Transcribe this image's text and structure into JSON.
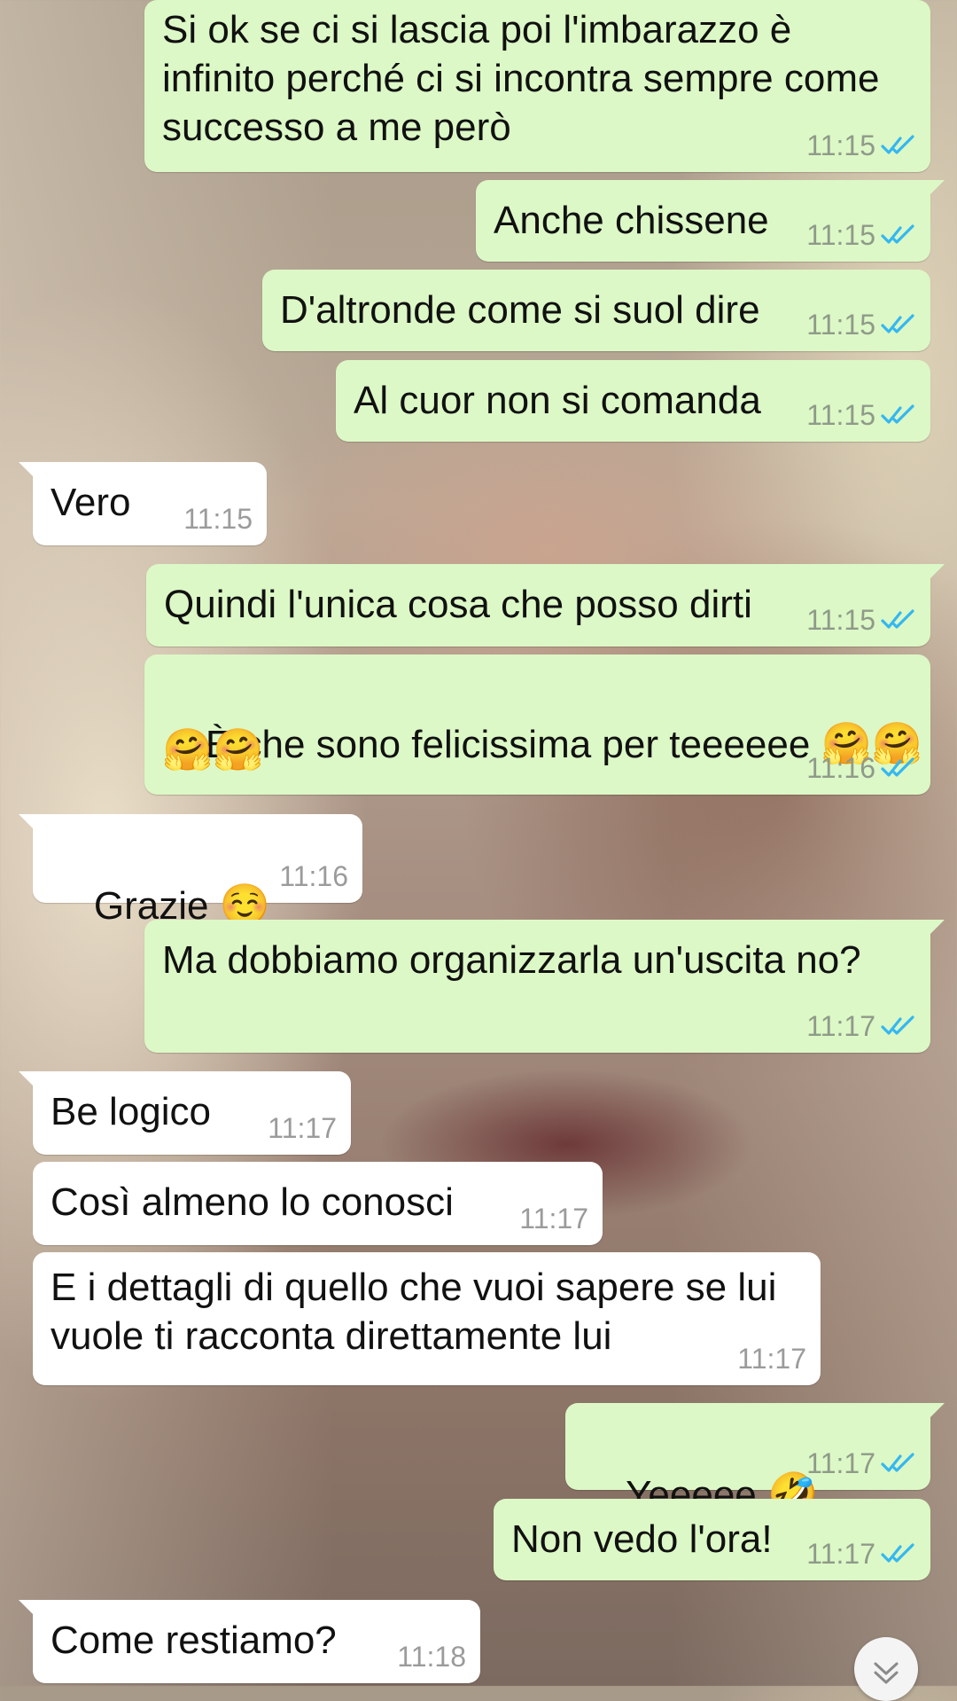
{
  "messages": [
    {
      "direction": "out",
      "lines": "Si ok se ci si lascia poi l'imbarazzo è\ninfinito perché ci si incontra sempre come\nsuccesso a me però",
      "time": "11:15",
      "read": true
    },
    {
      "direction": "out",
      "lines": "Anche chissene",
      "time": "11:15",
      "read": true
    },
    {
      "direction": "out",
      "lines": "D'altronde come si suol dire",
      "time": "11:15",
      "read": true
    },
    {
      "direction": "out",
      "lines": "Al cuor non si comanda",
      "time": "11:15",
      "read": true
    },
    {
      "direction": "in",
      "lines": "Vero",
      "time": "11:15"
    },
    {
      "direction": "out",
      "lines": "Quindi l'unica cosa che posso dirti",
      "time": "11:15",
      "read": true
    },
    {
      "direction": "out",
      "lines": "È che sono felicissima per teeeeee",
      "emoji_a": "🤗🤗",
      "emoji_b": "🤗🤗",
      "time": "11:16",
      "read": true
    },
    {
      "direction": "in",
      "lines": "Grazie",
      "emoji": "☺️",
      "time": "11:16"
    },
    {
      "direction": "out",
      "lines": "Ma dobbiamo organizzarla un'uscita no?",
      "time": "11:17",
      "read": true
    },
    {
      "direction": "in",
      "lines": "Be logico",
      "time": "11:17"
    },
    {
      "direction": "in",
      "lines": "Così almeno lo conosci",
      "time": "11:17"
    },
    {
      "direction": "in",
      "lines": "E i dettagli di quello che vuoi sapere se lui\nvuole ti racconta direttamente lui",
      "time": "11:17"
    },
    {
      "direction": "out",
      "lines": "Yeeeee",
      "emoji": "🤣",
      "time": "11:17",
      "read": true
    },
    {
      "direction": "out",
      "lines": "Non vedo l'ora!",
      "time": "11:17",
      "read": true
    },
    {
      "direction": "in",
      "lines": "Come restiamo?",
      "time": "11:18"
    }
  ],
  "icons": {
    "read_receipt": "double-check-icon",
    "scroll_down": "chevron-down-icon"
  },
  "colors": {
    "outgoing": "#dcf8c6",
    "incoming": "#ffffff",
    "read_ticks": "#34b7f1"
  }
}
